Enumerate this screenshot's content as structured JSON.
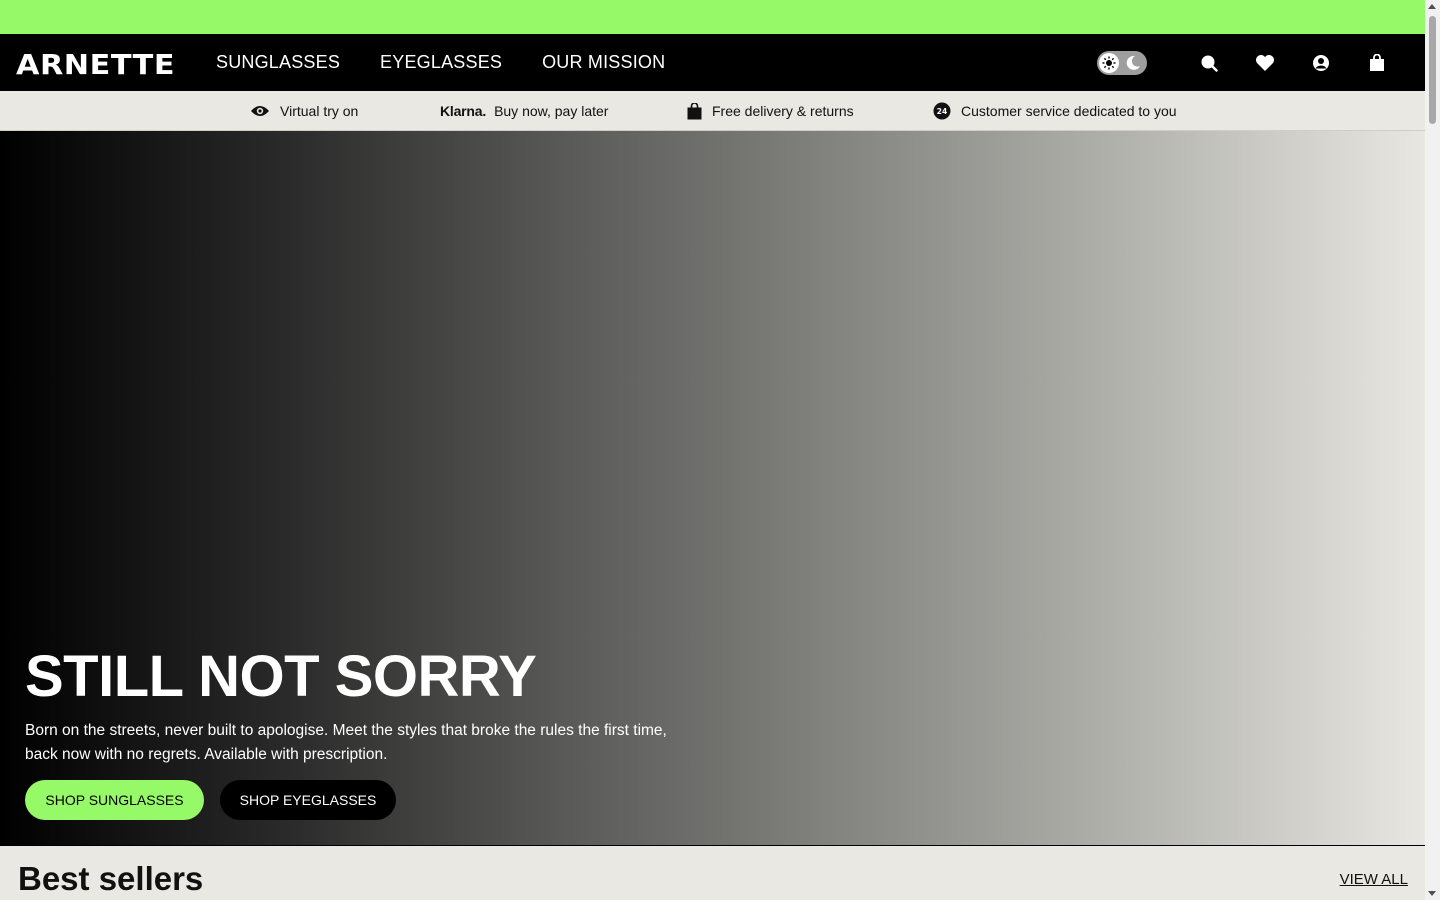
{
  "brand": {
    "logo_text": "ARNETTE",
    "accent_color": "#96f968"
  },
  "nav": {
    "links": [
      {
        "label": "SUNGLASSES"
      },
      {
        "label": "EYEGLASSES"
      },
      {
        "label": "OUR MISSION"
      }
    ],
    "icons": [
      "theme-toggle-icon",
      "search-icon",
      "heart-icon",
      "account-icon",
      "shopping-bag-icon"
    ]
  },
  "usps": [
    {
      "icon": "eye-icon",
      "label": "Virtual try on"
    },
    {
      "icon": "klarna-logo",
      "brand": "Klarna.",
      "label": "Buy now, pay later"
    },
    {
      "icon": "shopping-bag-icon",
      "label": "Free delivery & returns"
    },
    {
      "icon": "24h-support-icon",
      "label": "Customer service dedicated to you"
    }
  ],
  "hero": {
    "title": "STILL NOT SORRY",
    "description": "Born on the streets, never built to apologise. Meet the styles that broke the rules the first time, back now with no regrets. Available with prescription.",
    "primary_button": "SHOP SUNGLASSES",
    "secondary_button": "SHOP EYEGLASSES"
  },
  "best_sellers": {
    "title": "Best sellers",
    "view_all": "VIEW ALL"
  }
}
